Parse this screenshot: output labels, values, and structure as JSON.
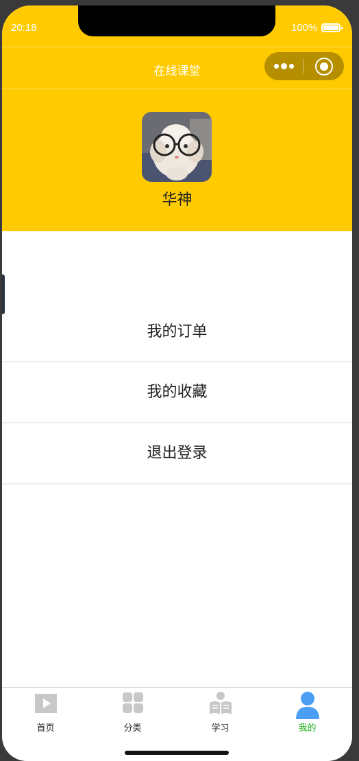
{
  "status_bar": {
    "time": "20:18",
    "battery": "100%"
  },
  "nav": {
    "title": "在线课堂"
  },
  "profile": {
    "username": "华神"
  },
  "menu": [
    {
      "label": "我的订单"
    },
    {
      "label": "我的收藏"
    },
    {
      "label": "退出登录"
    }
  ],
  "tabbar": [
    {
      "label": "首页",
      "icon": "play-icon"
    },
    {
      "label": "分类",
      "icon": "category-icon"
    },
    {
      "label": "学习",
      "icon": "study-icon"
    },
    {
      "label": "我的",
      "icon": "user-icon",
      "active": true
    }
  ],
  "colors": {
    "header": "#ffcb00",
    "active_tab_label": "#1aad19",
    "active_tab_icon": "#4a9ff5",
    "inactive_icon": "#c8c8c8"
  }
}
